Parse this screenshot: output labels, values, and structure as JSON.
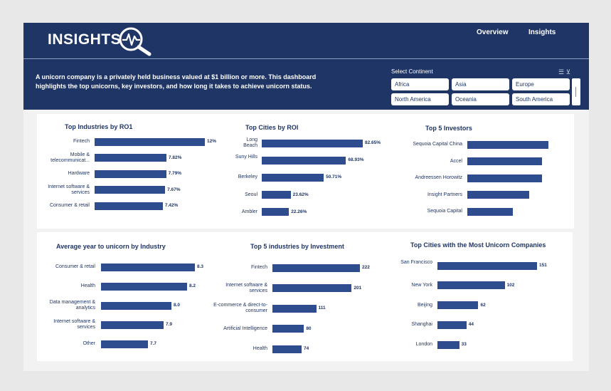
{
  "header": {
    "title": "INSIGHTS",
    "nav": [
      "Overview",
      "Insights"
    ],
    "description": "A unicorn company is a privately held business valued at $1 billion or more. This dashboard highlights the top unicorns, key investors, and how long it takes to achieve unicorn status."
  },
  "slicer": {
    "title": "Select Continent",
    "options": [
      "Africa",
      "Asia",
      "Europe",
      "North America",
      "Oceania",
      "South America"
    ]
  },
  "chart_data": [
    {
      "type": "bar",
      "title": "Top Industries by RO1",
      "categories": [
        "Fintech",
        "Mobile & telecommunicat...",
        "Hardware",
        "Internet software & services",
        "Consumer & retail"
      ],
      "values": [
        12,
        7.82,
        7.79,
        7.67,
        7.42
      ],
      "labels": [
        "12%",
        "7.82%",
        "7.79%",
        "7.67%",
        "7.42%"
      ],
      "xlim": [
        0,
        12
      ]
    },
    {
      "type": "bar",
      "title": "Top Cities by ROI",
      "categories": [
        "Long Beach",
        "Suny Hills",
        "Berkeley",
        "Seoul",
        "Ambler"
      ],
      "values": [
        82.65,
        68.93,
        50.71,
        23.62,
        22.26
      ],
      "labels": [
        "82.65%",
        "68.93%",
        "50.71%",
        "23.62%",
        "22.26%"
      ],
      "xlim": [
        0,
        82.65
      ]
    },
    {
      "type": "bar",
      "title": "Top 5 Investors",
      "categories": [
        "Sequoia Capital China",
        "Accel",
        "Andreessen Horowitz",
        "Insight Partners",
        "Sequoia Capital"
      ],
      "values": [
        10,
        9.2,
        9.2,
        7.6,
        5.6
      ],
      "labels": [
        "",
        "",
        "",
        "",
        ""
      ],
      "xlim": [
        0,
        10
      ]
    },
    {
      "type": "bar",
      "title": "Average year to unicorn by Industry",
      "categories": [
        "Consumer & retail",
        "Health",
        "Data management & analytics",
        "Internet software & services",
        "Other"
      ],
      "values": [
        8.3,
        8.2,
        8.0,
        7.9,
        7.7
      ],
      "labels": [
        "8.3",
        "8.2",
        "8.0",
        "7.9",
        "7.7"
      ],
      "xlim": [
        7.1,
        8.3
      ]
    },
    {
      "type": "bar",
      "title": "Top 5 industries by Investment",
      "categories": [
        "Fintech",
        "Internet software & services",
        "E-commerce & direct-to-consumer",
        "Artificial Intelligence",
        "Health"
      ],
      "values": [
        222,
        201,
        111,
        80,
        74
      ],
      "labels": [
        "222",
        "201",
        "111",
        "80",
        "74"
      ],
      "xlim": [
        0,
        222
      ]
    },
    {
      "type": "bar",
      "title": "Top Cities with the Most Unicorn Companies",
      "categories": [
        "San Francisco",
        "New York",
        "Beijing",
        "Shanghai",
        "London"
      ],
      "values": [
        151,
        102,
        62,
        44,
        33
      ],
      "labels": [
        "151",
        "102",
        "62",
        "44",
        "33"
      ],
      "xlim": [
        0,
        151
      ]
    }
  ],
  "colors": {
    "header": "#1f3566",
    "bar": "#2e4d8f",
    "text": "#1f3566"
  }
}
